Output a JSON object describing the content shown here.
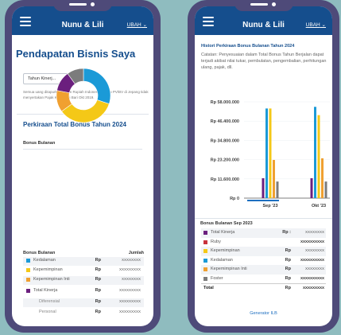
{
  "app": {
    "title": "Nunu & Lili",
    "user": "UBAH",
    "user_chevron": "⌄"
  },
  "left": {
    "page_title": "Pendapatan Bisnis Saya",
    "year_select": {
      "value": "Tahun Kinerj...",
      "chevron": "⌄"
    },
    "disclaimer": "Semua uang ditapurkan dalam Rupiah Indonesia. Rasio PV/BV di Jepang tidak menyertakan Pajak Konsumsi Bari Okt 2019.",
    "card_title": "Perkiraan Total Bonus Tahun 2024",
    "card_subtitle": "Bonus Bulanan",
    "table": {
      "col_left": "Bonus Bulanan",
      "col_right": "Jumlah",
      "rows": [
        {
          "label": "Kedalaman",
          "currency": "Rp",
          "value": "XXXXXXXX",
          "color": "#1b9ad7"
        },
        {
          "label": "Kepemimpinan",
          "currency": "Rp",
          "value": "XXXXXXXXX",
          "color": "#f4c817"
        },
        {
          "label": "Kepemimpinan Inti",
          "currency": "Rp",
          "value": "XXXXXXXX",
          "color": "#f0a030"
        },
        {
          "label": "Total Kinerja",
          "currency": "Rp",
          "value": "XXXXXXXXX",
          "color": "#6b1f7e"
        },
        {
          "label": "Diferensial",
          "currency": "Rp",
          "value": "XXXXXXXXX"
        },
        {
          "label": "Personal",
          "currency": "Rp",
          "value": "XXXXXXXXX"
        }
      ]
    }
  },
  "right": {
    "hist_title": "Histori Perkiraan Bonus Bulanan Tahun 2024",
    "hist_note": "Catatan: Penyesuaian dalam Total Bonus Tahun Berjalan dapat terjadi akibat nilai tukar, pembulatan, pengembalian, perhitungan ulang, pajak, dll.",
    "panel_title": "Bonus Bulanan Sep 2023",
    "rows": [
      {
        "label": "Total Kinerja",
        "currency": "Rp :",
        "value": "XXXXXXXX",
        "color": "#6b1f7e"
      },
      {
        "label": "Ruby",
        "currency": "",
        "value": "XXXXXXXXXX",
        "color": "#c8323c"
      },
      {
        "label": "Kepemimpinan",
        "currency": "Rp",
        "value": "XXXXXXXX",
        "color": "#f4c817"
      },
      {
        "label": "Kedalaman",
        "currency": "Rp",
        "value": "XXXXXXXXXX",
        "color": "#1b9ad7"
      },
      {
        "label": "Kepemimpinan Inti",
        "currency": "Rp",
        "value": "XXXXXXXX",
        "color": "#f0a030"
      },
      {
        "label": "Foster",
        "currency": "Rp",
        "value": "XXXXXXXXXX",
        "color": "#7c7c7c"
      }
    ],
    "total_label": "Total",
    "total_currency": "Rp",
    "total_value": "XXXXXXXXX",
    "generator_link": "Generator ILB"
  },
  "chart_data": [
    {
      "type": "pie",
      "title": "",
      "labels": [
        "Kedalaman",
        "Kepemimpinan",
        "Kepemimpinan Inti",
        "Total Kinerja",
        "Foster"
      ],
      "values": [
        30,
        35,
        13,
        12,
        10
      ],
      "colors": [
        "#1b9ad7",
        "#f4c817",
        "#f0a030",
        "#6b1f7e",
        "#7c7c7c"
      ]
    },
    {
      "type": "bar",
      "categories": [
        "Sep '23",
        "Okt '23"
      ],
      "ytick_labels": [
        "Rp 58.000.000",
        "Rp 46.400.000",
        "Rp 34.800.000",
        "Rp 23.200.000",
        "Rp 11.600.000",
        "Rp 0"
      ],
      "ylim": [
        0,
        58000000
      ],
      "series": [
        {
          "color": "#6b1f7e",
          "values": [
            12000000,
            12000000
          ]
        },
        {
          "color": "#1b9ad7",
          "values": [
            54000000,
            55000000
          ]
        },
        {
          "color": "#f4c817",
          "values": [
            54000000,
            50000000
          ]
        },
        {
          "color": "#f0a030",
          "values": [
            23000000,
            24000000
          ]
        },
        {
          "color": "#7c7c7c",
          "values": [
            10000000,
            10000000
          ]
        }
      ]
    }
  ]
}
